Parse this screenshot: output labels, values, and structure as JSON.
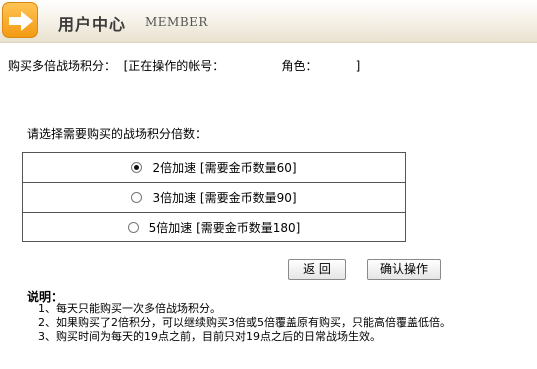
{
  "header": {
    "title": "用户中心",
    "subtitle": "MEMBER",
    "icon": "arrow-right-icon",
    "accent": "#f5a623"
  },
  "info": {
    "line": "购买多倍战场积分：  [正在操作的帐号：               角色：          ]"
  },
  "prompt": "请选择需要购买的战场积分倍数：",
  "options": [
    {
      "label": "2倍加速  [需要金币数量60]",
      "selected": true
    },
    {
      "label": "3倍加速  [需要金币数量90]",
      "selected": false
    },
    {
      "label": "5倍加速  [需要金币数量180]",
      "selected": false
    }
  ],
  "buttons": {
    "back": "返 回",
    "confirm": "确认操作"
  },
  "notes": {
    "title": "说明：",
    "items": [
      "1、每天只能购买一次多倍战场积分。",
      "2、如果购买了2倍积分，可以继续购买3倍或5倍覆盖原有购买，只能高倍覆盖低倍。",
      "3、购买时间为每天的19点之前，目前只对19点之后的日常战场生效。"
    ]
  }
}
